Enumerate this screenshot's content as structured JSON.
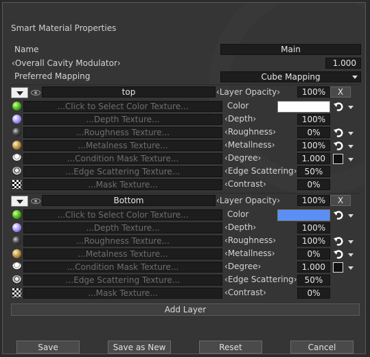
{
  "window": {
    "title": "Smart Material Properties"
  },
  "general": {
    "name_label": "Name",
    "name_value": "Main",
    "cavity_label": "Overall Cavity Modulator",
    "cavity_value": "1.000",
    "mapping_label": "Preferred Mapping",
    "mapping_value": "Cube Mapping"
  },
  "colors": {
    "layer1_color": "#ffffff",
    "layer2_color": "#5b8ff5"
  },
  "layers": [
    {
      "name": "top",
      "opacity_label": "Layer Opacity",
      "opacity_value": "100%",
      "remove_label": "X",
      "textures": {
        "color": "...Click to Select Color Texture...",
        "depth": "...Depth Texture...",
        "roughness": "...Roughness Texture...",
        "metalness": "...Metalness Texture...",
        "condition": "...Condition Mask Texture...",
        "edge": "...Edge Scattering Texture...",
        "mask": "...Mask Texture..."
      },
      "props": {
        "color_label": "Color",
        "depth_label": "Depth",
        "depth_value": "100%",
        "roughness_label": "Roughness",
        "roughness_value": "0%",
        "metalness_label": "Metallness",
        "metalness_value": "100%",
        "degree_label": "Degree",
        "degree_value": "1.000",
        "edge_label": "Edge Scattering",
        "edge_value": "50%",
        "contrast_label": "Contrast",
        "contrast_value": "0%"
      }
    },
    {
      "name": "Bottom",
      "opacity_label": "Layer Opacity",
      "opacity_value": "100%",
      "remove_label": "X",
      "textures": {
        "color": "...Click to Select Color Texture...",
        "depth": "...Depth Texture...",
        "roughness": "...Roughness Texture...",
        "metalness": "...Metalness Texture...",
        "condition": "...Condition Mask Texture...",
        "edge": "...Edge Scattering Texture...",
        "mask": "...Mask Texture..."
      },
      "props": {
        "color_label": "Color",
        "depth_label": "Depth",
        "depth_value": "100%",
        "roughness_label": "Roughness",
        "roughness_value": "100%",
        "metalness_label": "Metallness",
        "metalness_value": "0%",
        "degree_label": "Degree",
        "degree_value": "1.000",
        "edge_label": "Edge Scattering",
        "edge_value": "50%",
        "contrast_label": "Contrast",
        "contrast_value": "0%"
      }
    }
  ],
  "actions": {
    "add_layer": "Add Layer",
    "save": "Save",
    "save_as_new": "Save as New",
    "reset": "Reset",
    "cancel": "Cancel"
  },
  "icons": [
    "menu-icon",
    "eye-icon",
    "undo-icon",
    "color-ball-icon",
    "depth-ball-icon",
    "roughness-ball-icon",
    "metalness-ball-icon",
    "condition-mask-icon",
    "edge-scattering-icon",
    "checker-mask-icon"
  ]
}
